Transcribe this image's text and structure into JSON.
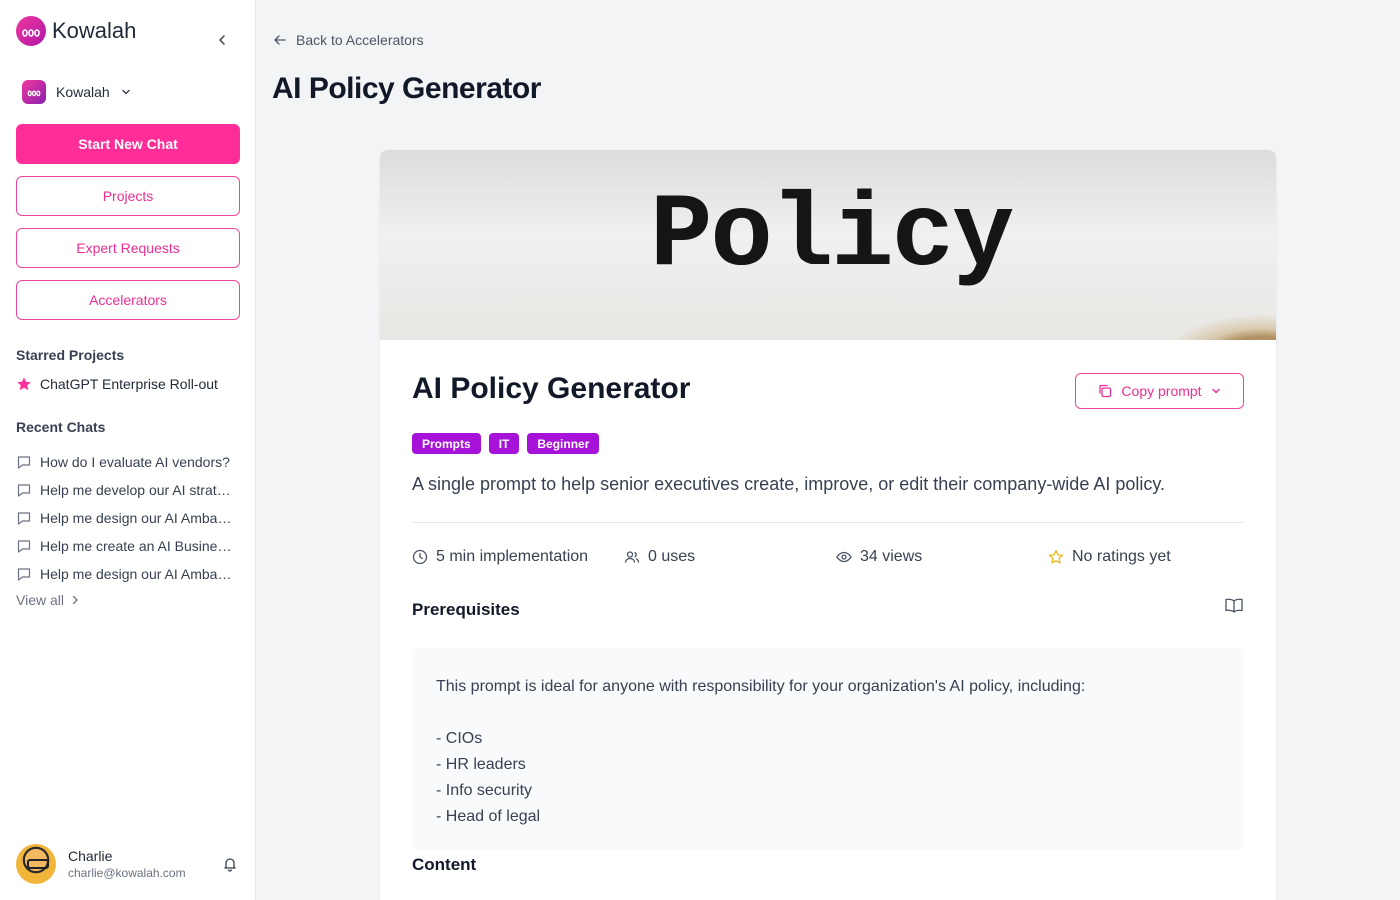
{
  "sidebar": {
    "app_name": "Kowalah",
    "workspace_name": "Kowalah",
    "start_chat_label": "Start New Chat",
    "nav": [
      {
        "label": "Projects"
      },
      {
        "label": "Expert Requests"
      },
      {
        "label": "Accelerators"
      }
    ],
    "starred_title": "Starred Projects",
    "starred": [
      {
        "label": "ChatGPT Enterprise Roll-out"
      }
    ],
    "recent_title": "Recent Chats",
    "recent_chats": [
      {
        "label": "How do I evaluate AI vendors?"
      },
      {
        "label": "Help me develop our AI strategy"
      },
      {
        "label": "Help me design our AI Ambassadors"
      },
      {
        "label": "Help me create an AI Business case"
      },
      {
        "label": "Help me design our AI Ambassadors"
      }
    ],
    "view_all_label": "View all",
    "user": {
      "name": "Charlie",
      "email": "charlie@kowalah.com"
    }
  },
  "main": {
    "back_label": "Back to Accelerators",
    "page_title": "AI Policy Generator",
    "hero_word": "Policy",
    "card_title": "AI Policy Generator",
    "copy_label": "Copy prompt",
    "tags": [
      "Prompts",
      "IT",
      "Beginner"
    ],
    "description": "A single prompt to help senior executives create, improve, or edit their company-wide AI policy.",
    "stats": {
      "implementation": "5 min implementation",
      "uses": "0 uses",
      "views": "34 views",
      "rating": "No ratings yet"
    },
    "prereq_title": "Prerequisites",
    "prereq_lines": [
      "This prompt is ideal for anyone with responsibility for your organization's AI policy, including:",
      "",
      "- CIOs",
      "- HR leaders",
      "- Info security",
      "- Head of legal"
    ],
    "content_title": "Content"
  },
  "colors": {
    "brand_pink": "#ff2d98",
    "tag_purple": "#a712d9",
    "star_yellow": "#eab308"
  }
}
